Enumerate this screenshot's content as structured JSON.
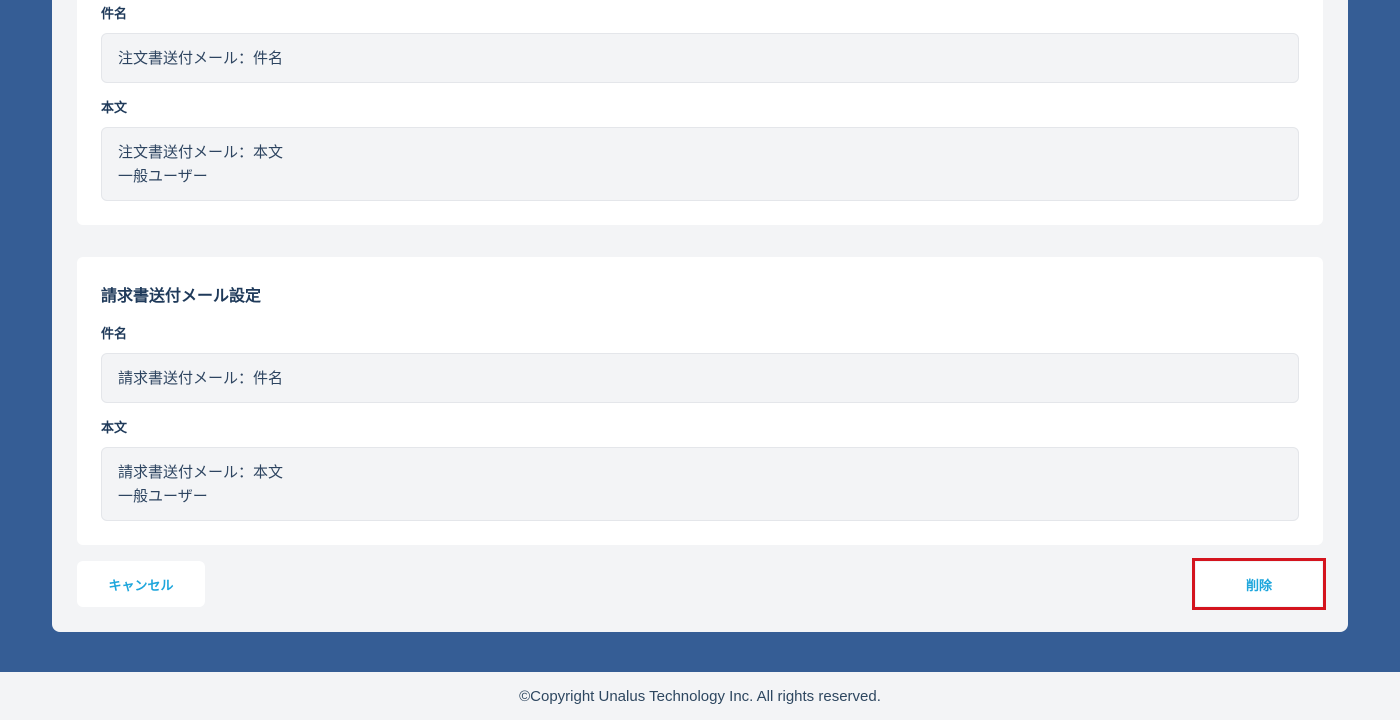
{
  "order_mail": {
    "subject_label": "件名",
    "subject_value": "注文書送付メール：件名",
    "body_label": "本文",
    "body_lines": [
      "注文書送付メール：本文",
      "一般ユーザー"
    ]
  },
  "invoice_mail": {
    "title": "請求書送付メール設定",
    "subject_label": "件名",
    "subject_value": "請求書送付メール：件名",
    "body_label": "本文",
    "body_lines": [
      "請求書送付メール：本文",
      "一般ユーザー"
    ]
  },
  "actions": {
    "cancel_label": "キャンセル",
    "delete_label": "削除"
  },
  "footer": {
    "copyright": "©Copyright Unalus Technology Inc. All rights reserved."
  },
  "colors": {
    "background": "#355d95",
    "accent": "#1ea6dc",
    "highlight": "#d4141e"
  }
}
